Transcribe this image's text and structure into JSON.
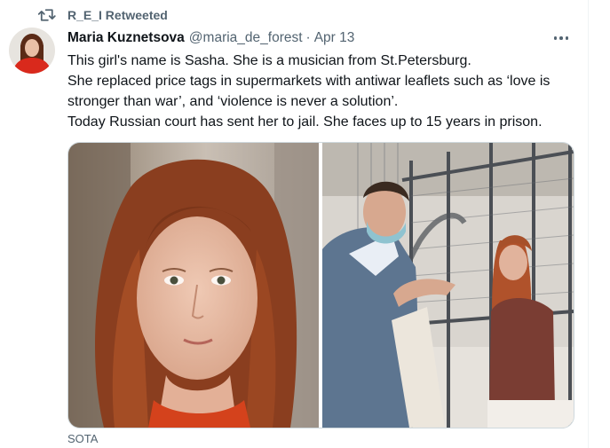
{
  "retweet": {
    "label": "R_E_I Retweeted"
  },
  "author": {
    "name": "Maria Kuznetsova",
    "handle": "@maria_de_forest",
    "separator": "·",
    "date": "Apr 13"
  },
  "tweet": {
    "lines": [
      "This girl's name is Sasha. She is a musician from St.Petersburg.",
      "She replaced price tags in supermarkets with antiwar leaflets such as ‘love is",
      "stronger than war’, and ‘violence is never a solution’.",
      "Today Russian court has sent her to jail. She faces up to 15 years in prison."
    ]
  },
  "media": {
    "source": "SOTA"
  },
  "icons": {
    "retweet": "retweet-icon",
    "more": "more-icon",
    "avatar": "profile-avatar"
  },
  "colors": {
    "secondary_text": "#536471",
    "primary_text": "#0f1419",
    "border": "#cfd9de"
  }
}
